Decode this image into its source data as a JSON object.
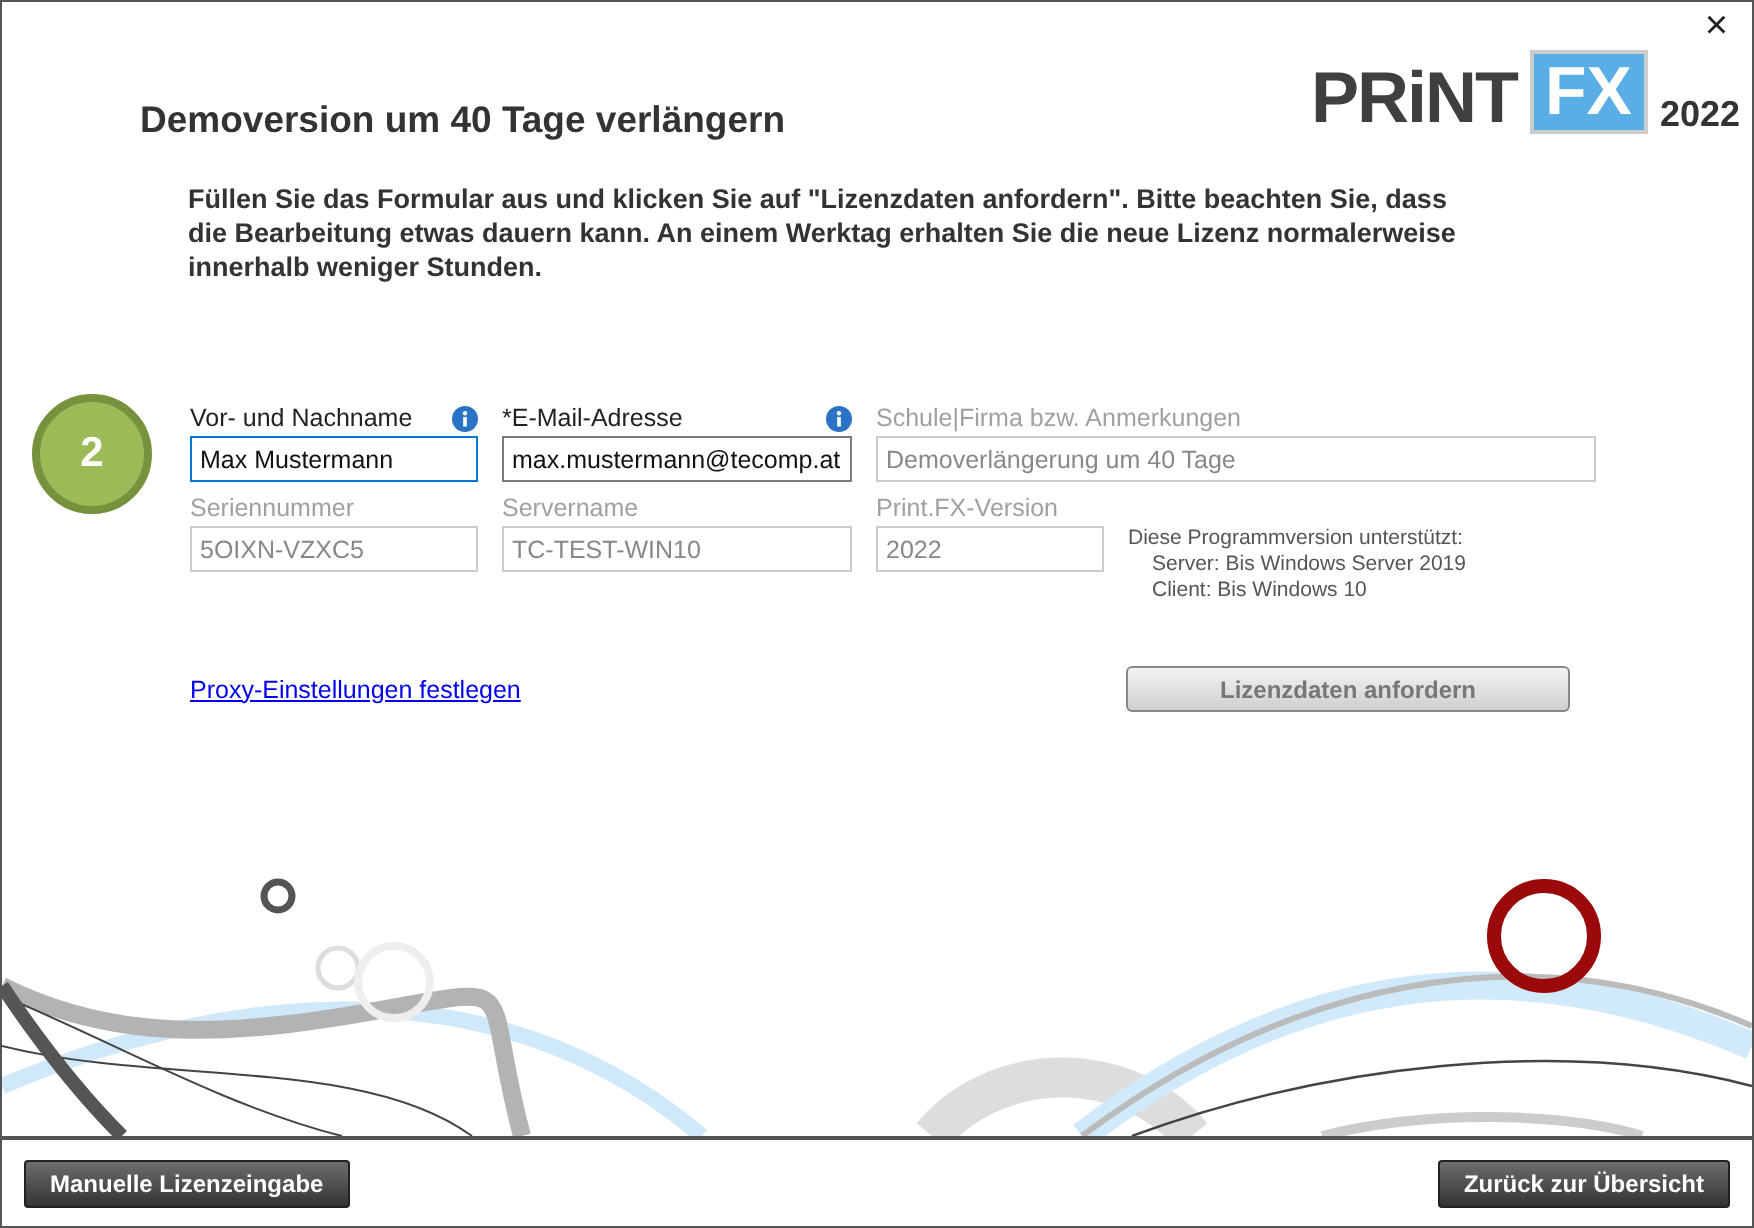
{
  "logo": {
    "word": "PRiNT",
    "badge": "FX",
    "year": "2022"
  },
  "close": "×",
  "title": "Demoversion um 40 Tage verlängern",
  "intro": "Füllen Sie das Formular aus und klicken Sie auf \"Lizenzdaten anfordern\". Bitte beachten Sie, dass die Bearbeitung etwas dauern kann. An einem Werktag erhalten Sie die neue Lizenz normalerweise innerhalb weniger Stunden.",
  "step": "2",
  "fields": [
    {
      "label": "Vor- und Nachname",
      "value": "Max Mustermann",
      "disabled": false,
      "focused": true,
      "info": true
    },
    {
      "label": "*E-Mail-Adresse",
      "value": "max.mustermann@tecomp.at",
      "disabled": false,
      "focused": false,
      "info": true
    },
    {
      "label": "Schule|Firma bzw. Anmerkungen",
      "value": "Demoverlängerung um 40 Tage",
      "disabled": true,
      "focused": false,
      "info": false
    },
    {
      "label": "Seriennummer",
      "value": "5OIXN-VZXC5",
      "disabled": true,
      "focused": false,
      "info": false
    },
    {
      "label": "Servername",
      "value": "TC-TEST-WIN10",
      "disabled": true,
      "focused": false,
      "info": false
    },
    {
      "label": "Print.FX-Version",
      "value": "2022",
      "disabled": true,
      "focused": false,
      "info": false
    }
  ],
  "support": {
    "heading": "Diese Programmversion unterstützt:",
    "lines": [
      "Server: Bis Windows Server 2019",
      "Client: Bis Windows 10"
    ]
  },
  "proxy_link": "Proxy-Einstellungen festlegen",
  "request_button": {
    "label": "Lizenzdaten anfordern",
    "disabled": true
  },
  "footer": {
    "left": "Manuelle Lizenzeingabe",
    "right": "Zurück zur Übersicht"
  }
}
